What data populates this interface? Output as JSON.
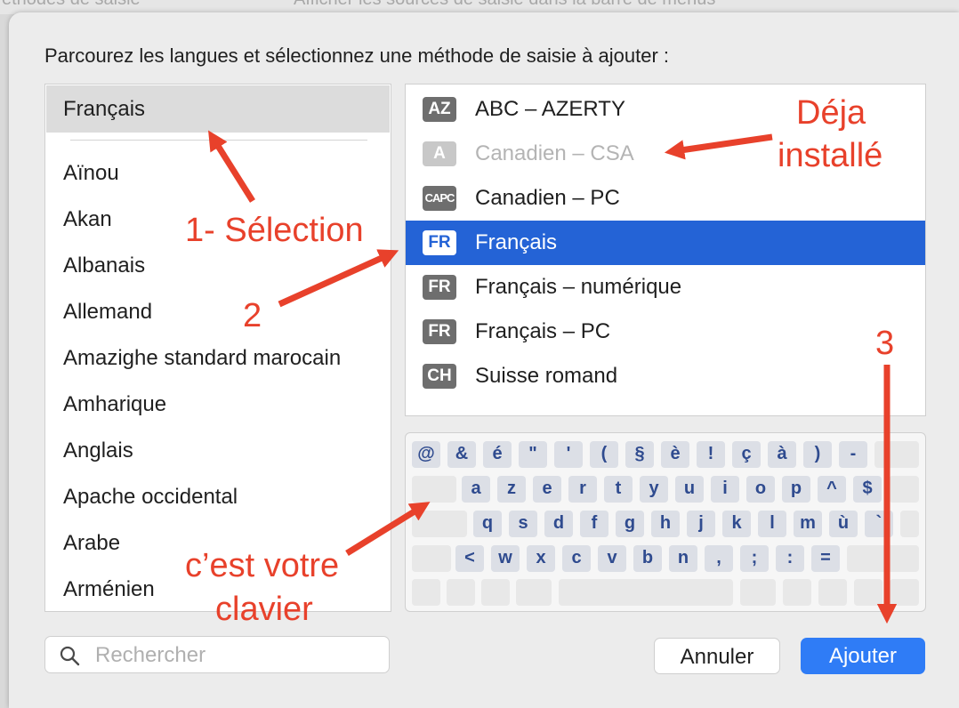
{
  "background": {
    "text_left": "éthodes de saisie",
    "text_right": "Afficher les sources de saisie dans la barre de menus"
  },
  "dialog": {
    "prompt": "Parcourez les langues et sélectionnez une méthode de saisie à ajouter :",
    "languages": {
      "selected": "Français",
      "items": [
        "Aïnou",
        "Akan",
        "Albanais",
        "Allemand",
        "Amazighe standard marocain",
        "Amharique",
        "Anglais",
        "Apache occidental",
        "Arabe",
        "Arménien"
      ]
    },
    "methods": [
      {
        "badge": "AZ",
        "label": "ABC – AZERTY"
      },
      {
        "badge": "A",
        "label": "Canadien – CSA"
      },
      {
        "badge": "CAPC",
        "label": "Canadien – PC"
      },
      {
        "badge": "FR",
        "label": "Français"
      },
      {
        "badge": "FR",
        "label": "Français – numérique"
      },
      {
        "badge": "FR",
        "label": "Français – PC"
      },
      {
        "badge": "CH",
        "label": "Suisse romand"
      }
    ],
    "keyboard": {
      "row1": [
        "@",
        "&",
        "é",
        "\"",
        "'",
        "(",
        "§",
        "è",
        "!",
        "ç",
        "à",
        ")",
        "-"
      ],
      "row2": [
        "a",
        "z",
        "e",
        "r",
        "t",
        "y",
        "u",
        "i",
        "o",
        "p",
        "^",
        "$"
      ],
      "row3": [
        "q",
        "s",
        "d",
        "f",
        "g",
        "h",
        "j",
        "k",
        "l",
        "m",
        "ù",
        "`"
      ],
      "row4": [
        "<",
        "w",
        "x",
        "c",
        "v",
        "b",
        "n",
        ",",
        ";",
        ":",
        "="
      ]
    },
    "search": {
      "placeholder": "Rechercher"
    },
    "buttons": {
      "cancel": "Annuler",
      "add": "Ajouter"
    }
  },
  "annotations": {
    "selection": "1- Sélection",
    "step2": "2",
    "step3": "3",
    "already_installed_line1": "Déja",
    "already_installed_line2": "installé",
    "keyboard_note_line1": "c’est votre",
    "keyboard_note_line2": "clavier",
    "color": "#e8412b"
  },
  "colors": {
    "selection_blue": "#2463d6",
    "button_blue": "#2f7cf6",
    "key_text": "#2f4b8f"
  }
}
